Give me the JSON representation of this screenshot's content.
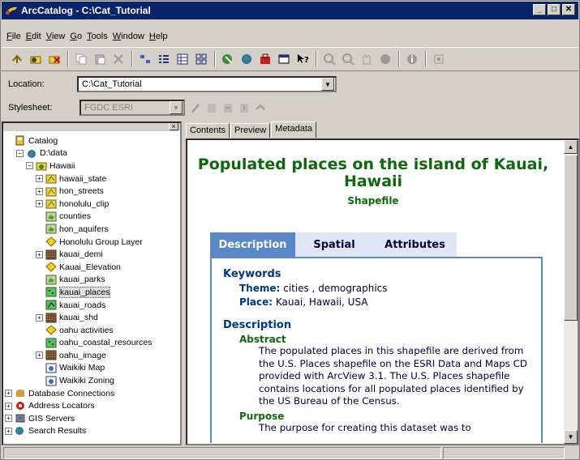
{
  "title": "ArcCatalog - C:\\Cat_Tutorial",
  "window_buttons": [
    "_",
    "□",
    "✕"
  ],
  "menu": [
    "File",
    "Edit",
    "View",
    "Go",
    "Tools",
    "Window",
    "Help"
  ],
  "location": {
    "label": "Location:",
    "value": "C:\\Cat_Tutorial"
  },
  "stylesheet": {
    "label": "Stylesheet:",
    "value": "FGDC ESRI"
  },
  "tree": [
    {
      "label": "Catalog",
      "level": 0,
      "exp": "",
      "icon": "catalog"
    },
    {
      "label": "D:\\data",
      "level": 1,
      "exp": "-",
      "icon": "folder-drive"
    },
    {
      "label": "Hawaii",
      "level": 2,
      "exp": "-",
      "icon": "folder"
    },
    {
      "label": "hawaii_state",
      "level": 3,
      "exp": "+",
      "icon": "coverage"
    },
    {
      "label": "hon_streets",
      "level": 3,
      "exp": "+",
      "icon": "coverage"
    },
    {
      "label": "honolulu_clip",
      "level": 3,
      "exp": "+",
      "icon": "coverage"
    },
    {
      "label": "counties",
      "level": 3,
      "exp": "",
      "icon": "shape-poly"
    },
    {
      "label": "hon_aquifers",
      "level": 3,
      "exp": "",
      "icon": "shape-poly"
    },
    {
      "label": "Honolulu Group Layer",
      "level": 3,
      "exp": "",
      "icon": "layer"
    },
    {
      "label": "kauai_demi",
      "level": 3,
      "exp": "+",
      "icon": "grid"
    },
    {
      "label": "Kauai_Elevation",
      "level": 3,
      "exp": "",
      "icon": "layer"
    },
    {
      "label": "kauai_parks",
      "level": 3,
      "exp": "",
      "icon": "shape-poly"
    },
    {
      "label": "kauai_places",
      "level": 3,
      "exp": "",
      "icon": "shape-point",
      "sel": true
    },
    {
      "label": "kauai_roads",
      "level": 3,
      "exp": "",
      "icon": "shape-line"
    },
    {
      "label": "kauai_shd",
      "level": 3,
      "exp": "+",
      "icon": "grid"
    },
    {
      "label": "oahu activities",
      "level": 3,
      "exp": "",
      "icon": "layer"
    },
    {
      "label": "oahu_coastal_resources",
      "level": 3,
      "exp": "",
      "icon": "shape-point"
    },
    {
      "label": "oahu_image",
      "level": 3,
      "exp": "+",
      "icon": "grid"
    },
    {
      "label": "Waikiki Map",
      "level": 3,
      "exp": "",
      "icon": "map"
    },
    {
      "label": "Waikiki Zoning",
      "level": 3,
      "exp": "",
      "icon": "map"
    },
    {
      "label": "Database Connections",
      "level": 0,
      "exp": "+",
      "icon": "db"
    },
    {
      "label": "Address Locators",
      "level": 0,
      "exp": "+",
      "icon": "locator"
    },
    {
      "label": "GIS Servers",
      "level": 0,
      "exp": "+",
      "icon": "server"
    },
    {
      "label": "Search Results",
      "level": 0,
      "exp": "+",
      "icon": "search"
    }
  ],
  "tabs": [
    "Contents",
    "Preview",
    "Metadata"
  ],
  "metadata": {
    "title": "Populated places on the island of Kauai, Hawaii",
    "subtitle": "Shapefile",
    "tabs": [
      "Description",
      "Spatial",
      "Attributes"
    ],
    "keywords_h": "Keywords",
    "theme_label": "Theme:",
    "theme_value": "cities , demographics",
    "place_label": "Place:",
    "place_value": "Kauai, Hawaii, USA",
    "description_h": "Description",
    "abstract_h": "Abstract",
    "abstract": "The populated places in this shapefile are derived from the U.S. Places shapefile on the ESRI Data and Maps CD provided with ArcView 3.1. The U.S. Places shapefile contains locations for all populated places identified by the US Bureau of the Census.",
    "purpose_h": "Purpose",
    "purpose": "The purpose for creating this dataset was to"
  }
}
